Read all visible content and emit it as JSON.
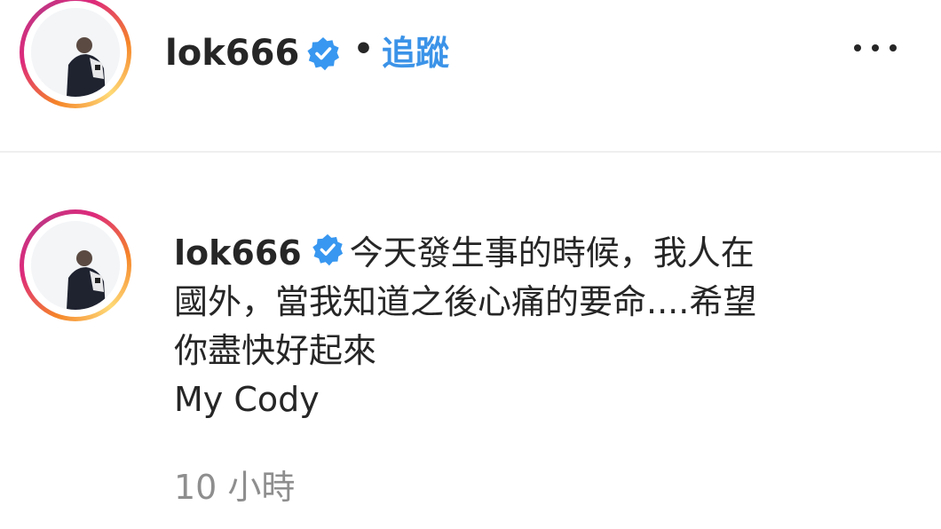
{
  "header": {
    "username": "lok666",
    "separator": "•",
    "follow_label": "追蹤",
    "verified_icon": "verified-badge-icon",
    "more_icon": "more-options-icon"
  },
  "comment": {
    "username": "lok666",
    "text_line1": "今天發生事的時候，我人在",
    "text_line2": "國外，當我知道之後心痛的要命....希望",
    "text_line3": "你盡快好起來",
    "text_line4": "My Cody",
    "timestamp": "10 小時"
  },
  "colors": {
    "link": "#3b93e8",
    "verified": "#3897f0",
    "muted": "#8e8e8e",
    "text": "#262626"
  }
}
